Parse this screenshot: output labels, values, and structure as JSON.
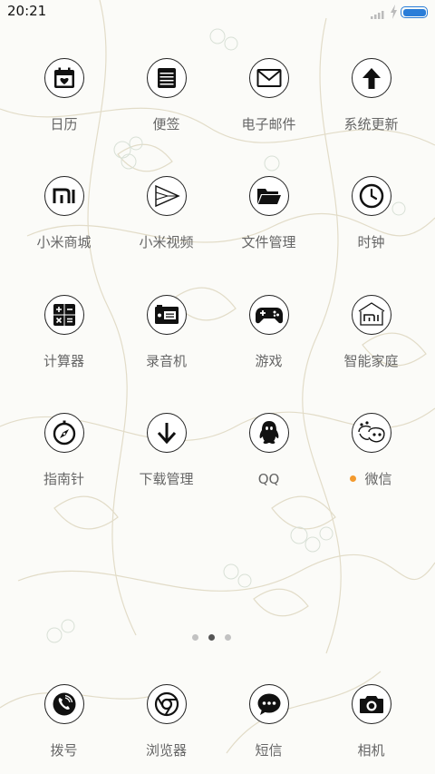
{
  "status_bar": {
    "time": "20:21",
    "battery_color": "#2a7dd8",
    "battery_level": 1.0
  },
  "apps": [
    {
      "label": "日历",
      "icon": "calendar-icon"
    },
    {
      "label": "便签",
      "icon": "notes-icon"
    },
    {
      "label": "电子邮件",
      "icon": "email-icon"
    },
    {
      "label": "系统更新",
      "icon": "update-arrow-icon"
    },
    {
      "label": "小米商城",
      "icon": "mi-store-icon"
    },
    {
      "label": "小米视频",
      "icon": "video-play-icon"
    },
    {
      "label": "文件管理",
      "icon": "folder-icon"
    },
    {
      "label": "时钟",
      "icon": "clock-icon"
    },
    {
      "label": "计算器",
      "icon": "calculator-icon"
    },
    {
      "label": "录音机",
      "icon": "recorder-icon"
    },
    {
      "label": "游戏",
      "icon": "gamepad-icon"
    },
    {
      "label": "智能家庭",
      "icon": "smart-home-icon"
    },
    {
      "label": "指南针",
      "icon": "compass-icon"
    },
    {
      "label": "下载管理",
      "icon": "download-icon"
    },
    {
      "label": "QQ",
      "icon": "qq-penguin-icon"
    },
    {
      "label": "微信",
      "icon": "wechat-icon",
      "badge_color": "#f39a2e"
    }
  ],
  "page_indicator": {
    "count": 3,
    "active": 2
  },
  "dock": [
    {
      "label": "拨号",
      "icon": "phone-icon"
    },
    {
      "label": "浏览器",
      "icon": "browser-icon"
    },
    {
      "label": "短信",
      "icon": "message-icon"
    },
    {
      "label": "相机",
      "icon": "camera-icon"
    }
  ]
}
